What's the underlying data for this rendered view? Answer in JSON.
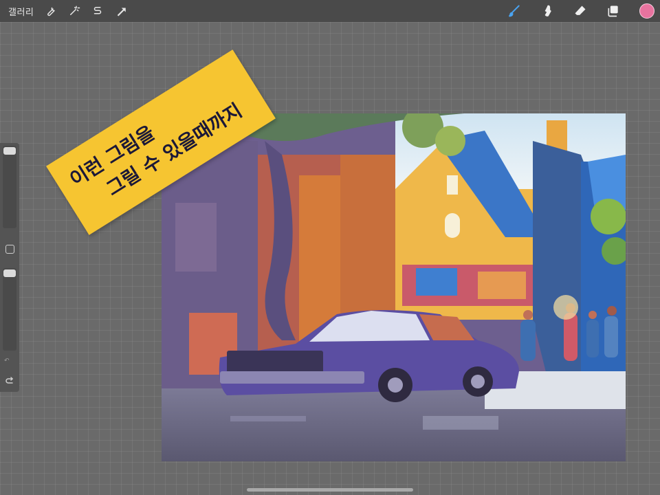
{
  "toolbar": {
    "gallery_label": "갤러리",
    "left_tools": [
      {
        "name": "actions-wrench-icon"
      },
      {
        "name": "adjustments-wand-icon"
      },
      {
        "name": "selection-icon"
      },
      {
        "name": "transform-arrow-icon"
      }
    ],
    "right_tools": [
      {
        "name": "brush-icon",
        "color": "#4aa3f0",
        "active": true
      },
      {
        "name": "smudge-icon",
        "color": "#efefef"
      },
      {
        "name": "eraser-icon",
        "color": "#efefef"
      },
      {
        "name": "layers-icon",
        "color": "#efefef"
      }
    ],
    "current_color": "#e8739f"
  },
  "sticky_note": {
    "line1": "이런 그림을",
    "line2": "그릴 수 있을때까지",
    "color": "#f6c531"
  }
}
